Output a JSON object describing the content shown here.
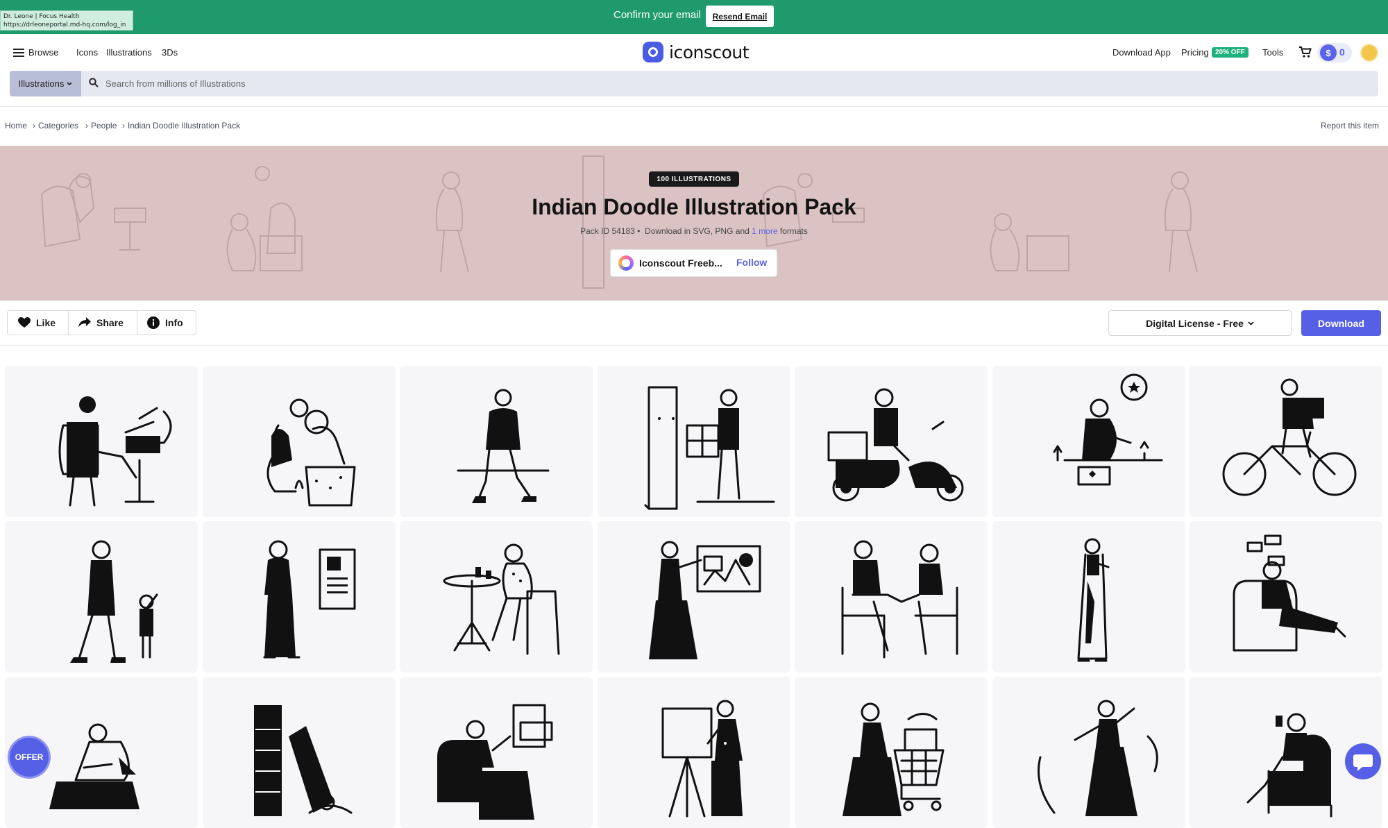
{
  "tooltip": {
    "line1": "Dr. Leone | Focus Health",
    "line2": "https://drleoneportal.md-hq.com/log_in"
  },
  "banner": {
    "message": "Confirm your email",
    "resend_label": "Resend Email"
  },
  "nav": {
    "browse": "Browse",
    "icons": "Icons",
    "illustrations": "Illustrations",
    "threeds": "3Ds",
    "logo": "iconscout",
    "download_app": "Download App",
    "pricing": "Pricing",
    "pricing_badge": "20% OFF",
    "tools": "Tools",
    "coin_count": "0",
    "coin_symbol": "$"
  },
  "search": {
    "category": "Illustrations",
    "placeholder": "Search from millions of Illustrations"
  },
  "breadcrumb": {
    "home": "Home",
    "categories": "Categories",
    "people": "People",
    "current": "Indian Doodle Illustration Pack",
    "sep": "›"
  },
  "report": "Report this item",
  "hero": {
    "badge": "100 ILLUSTRATIONS",
    "title": "Indian Doodle Illustration Pack",
    "pack_id": "Pack ID 54183 •",
    "download_in": "Download in SVG, PNG and",
    "more": "1 more",
    "formats": "formats",
    "author": "Iconscout Freeb...",
    "follow": "Follow"
  },
  "actions": {
    "like": "Like",
    "share": "Share",
    "info": "Info"
  },
  "license": {
    "label": "Digital License - Free",
    "chevron": "⌄"
  },
  "download": "Download",
  "offer": "OFFER",
  "grid": [
    {
      "name": "man-gramophone-illustration"
    },
    {
      "name": "woman-cat-thinking-illustration"
    },
    {
      "name": "man-walking-hoodie-illustration"
    },
    {
      "name": "delivery-door-illustration"
    },
    {
      "name": "scooter-delivery-illustration"
    },
    {
      "name": "woman-painting-flower-illustration"
    },
    {
      "name": "man-cycling-illustration"
    },
    {
      "name": "father-daughter-walk-illustration"
    },
    {
      "name": "woman-resume-illustration"
    },
    {
      "name": "woman-cafe-table-illustration"
    },
    {
      "name": "woman-presentation-board-illustration"
    },
    {
      "name": "couple-chatting-illustration"
    },
    {
      "name": "woman-saree-phone-illustration"
    },
    {
      "name": "woman-chair-messages-illustration"
    },
    {
      "name": "woman-sitting-floor-illustration"
    },
    {
      "name": "man-bookshelf-illustration"
    },
    {
      "name": "woman-armchair-card-illustration"
    },
    {
      "name": "woman-easel-painting-illustration"
    },
    {
      "name": "woman-shopping-cart-illustration"
    },
    {
      "name": "woman-dancing-illustration"
    },
    {
      "name": "woman-armchair-phone-illustration"
    }
  ]
}
